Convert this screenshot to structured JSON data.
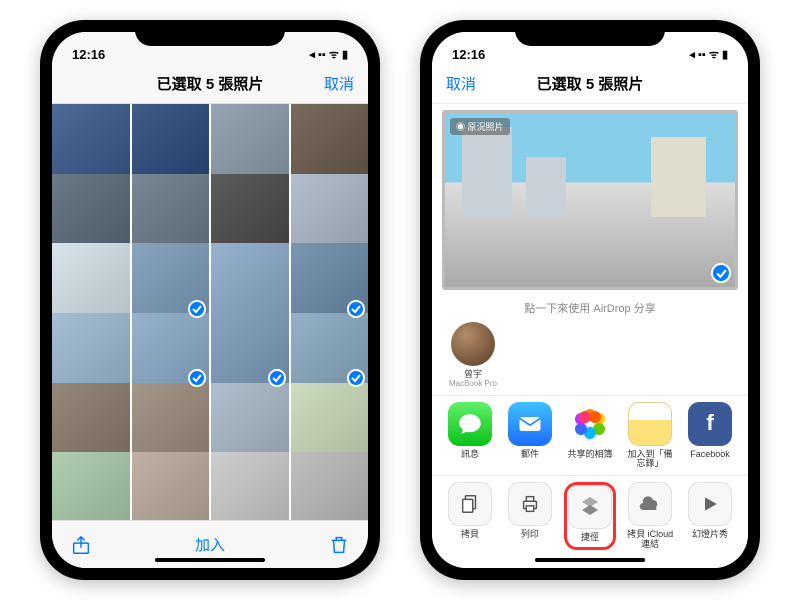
{
  "leftPhone": {
    "status": {
      "time": "12:16",
      "indicators": "◂ ▪▪ ᯤ ▮"
    },
    "nav": {
      "title": "已選取 5 張照片",
      "cancel": "取消"
    },
    "toolbar": {
      "center": "加入"
    },
    "thumbs": {
      "selected_positions": [
        9,
        11,
        13,
        14,
        15
      ]
    }
  },
  "rightPhone": {
    "status": {
      "time": "12:16",
      "indicators": "◂ ▪▪ ᯤ ▮"
    },
    "nav": {
      "cancel": "取消",
      "title": "已選取 5 張照片"
    },
    "preview": {
      "live_badge": "◉ 原況照片",
      "caption": "點一下來使用 AirDrop 分享"
    },
    "airdrop": {
      "name": "曾宇",
      "device": "MacBook Pro"
    },
    "apps": [
      {
        "id": "messages",
        "label": "訊息"
      },
      {
        "id": "mail",
        "label": "郵件"
      },
      {
        "id": "shared-album",
        "label": "共享的相簿"
      },
      {
        "id": "notes",
        "label": "加入到「備忘錄」"
      },
      {
        "id": "facebook",
        "label": "Facebook"
      }
    ],
    "actions": [
      {
        "id": "copy",
        "label": "拷貝"
      },
      {
        "id": "print",
        "label": "列印"
      },
      {
        "id": "shortcuts",
        "label": "捷徑",
        "highlighted": true
      },
      {
        "id": "icloud-link",
        "label": "拷貝 iCloud 連結"
      },
      {
        "id": "slideshow",
        "label": "幻燈片秀"
      }
    ]
  }
}
